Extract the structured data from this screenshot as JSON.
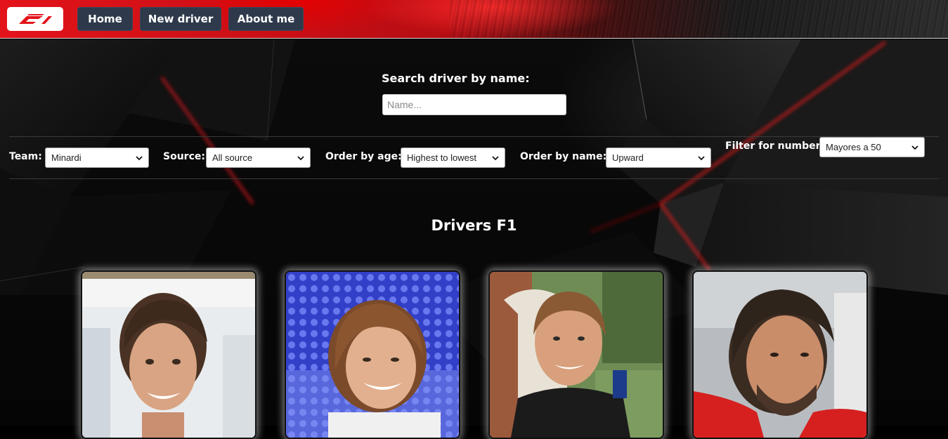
{
  "header": {
    "logo_alt": "F1",
    "nav": [
      {
        "label": "Home"
      },
      {
        "label": "New driver"
      },
      {
        "label": "About me"
      }
    ]
  },
  "search": {
    "label": "Search driver by name:",
    "placeholder": "Name..."
  },
  "filters": {
    "team": {
      "label": "Team:",
      "value": "Minardi"
    },
    "source": {
      "label": "Source:",
      "value": "All source"
    },
    "order_age": {
      "label": "Order by age:",
      "value": "Highest to lowest"
    },
    "order_name": {
      "label": "Order by name:",
      "value": "Upward"
    },
    "number": {
      "label": "Filter for number",
      "value": "Mayores a 50"
    }
  },
  "main": {
    "title": "Drivers F1",
    "drivers": [
      {
        "photo": "driver-photo-1"
      },
      {
        "photo": "driver-photo-2"
      },
      {
        "photo": "driver-photo-3"
      },
      {
        "photo": "driver-photo-4"
      }
    ]
  },
  "colors": {
    "brand_red": "#e3131a",
    "nav_button": "#2e3a4b"
  }
}
